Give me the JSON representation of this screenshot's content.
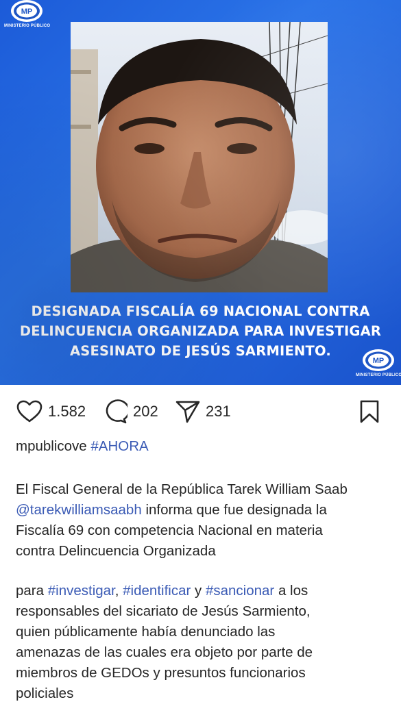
{
  "post_image": {
    "logo_caption": "MINISTERIO PÚBLICO",
    "logo_letters": "MP",
    "headline_lines": [
      "DESIGNADA FISCALÍA 69 NACIONAL CONTRA",
      "DELINCUENCIA ORGANIZADA PARA INVESTIGAR",
      "ASESINATO DE JESÚS SARMIENTO."
    ]
  },
  "actions": {
    "likes": "1.582",
    "comments": "202",
    "shares": "231"
  },
  "caption": {
    "username": "mpublicove",
    "hashtag": "#AHORA",
    "para1_part1": "El Fiscal General de la República Tarek William Saab",
    "para1_mention": "@tarekwilliamsaabh",
    "para1_part2": " informa que fue designada la",
    "para1_line3": "Fiscalía 69 con competencia Nacional en materia",
    "para1_line4": "contra Delincuencia Organizada",
    "para2_text1": "para ",
    "para2_tag1": "#investigar",
    "para2_text2": ", ",
    "para2_tag2": "#identificar",
    "para2_text3": " y ",
    "para2_tag3": "#sancionar",
    "para2_text4": " a los",
    "para2_line2": "responsables del sicariato de Jesús Sarmiento,",
    "para2_line3": "quien públicamente había denunciado las",
    "para2_line4": "amenazas de las cuales era objeto por parte de",
    "para2_line5": "miembros de GEDOs y presuntos funcionarios",
    "para2_line6": "policiales"
  },
  "colors": {
    "brand_blue": "#1f63dd",
    "hashtag": "#3b5bb5",
    "text": "#262626"
  },
  "icons": [
    "heart-icon",
    "comment-icon",
    "share-icon",
    "bookmark-icon"
  ]
}
